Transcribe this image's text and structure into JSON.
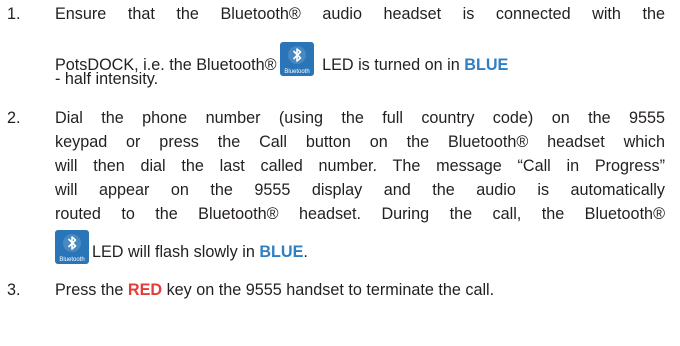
{
  "steps": [
    {
      "number": "1.",
      "line1": "Ensure that the Bluetooth® audio headset is connected with the",
      "line2_pre": "PotsDOCK, i.e. the Bluetooth®",
      "line2_mid": "LED is turned on in",
      "line2_color": "BLUE",
      "line3": "- half intensity."
    },
    {
      "number": "2.",
      "line1": "Dial the phone number (using the full country code) on the 9555",
      "line2": "keypad or press the Call button on the Bluetooth® headset which",
      "line3": "will then dial the last called number. The message “Call in Progress”",
      "line4": "will appear on the 9555 display and the audio is automatically",
      "line5": "routed to the Bluetooth® headset. During the call, the Bluetooth®",
      "line6_pre": "LED will flash slowly in",
      "line6_color": "BLUE",
      "line6_post": "."
    },
    {
      "number": "3.",
      "pre": "Press the",
      "color": "RED",
      "post": "key on the 9555 handset to terminate the call."
    }
  ],
  "icons": {
    "bluetooth": "bluetooth-icon",
    "icon_caption": "Bluetooth",
    "bg_color": "#2a75b8",
    "symbol_color": "#ffffff"
  },
  "colors": {
    "text": "#231f20",
    "blue": "#2f7fc2",
    "red": "#e53b3b"
  }
}
